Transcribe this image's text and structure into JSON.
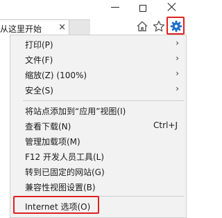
{
  "tab": {
    "title": "从这里开始",
    "close_glyph": "×"
  },
  "toolbar": {
    "icons": [
      "home-icon",
      "star-icon",
      "gear-icon"
    ],
    "highlight_color": "#e02020"
  },
  "menu": {
    "items": [
      {
        "label": "打印(P)",
        "submenu": true
      },
      {
        "label": "文件(F)",
        "submenu": true
      },
      {
        "label": "缩放(Z) (100%)",
        "submenu": true
      },
      {
        "label": "安全(S)",
        "submenu": true
      },
      {
        "label": "将站点添加到“应用”视图(I)"
      },
      {
        "label": "查看下载(N)",
        "shortcut": "Ctrl+J"
      },
      {
        "label": "管理加载项(M)"
      },
      {
        "label": "F12 开发人员工具(L)"
      },
      {
        "label": "转到已固定的网站(G)"
      },
      {
        "label": "兼容性视图设置(B)"
      },
      {
        "label": "Internet 选项(O)"
      }
    ],
    "arrow_glyph": "›"
  }
}
